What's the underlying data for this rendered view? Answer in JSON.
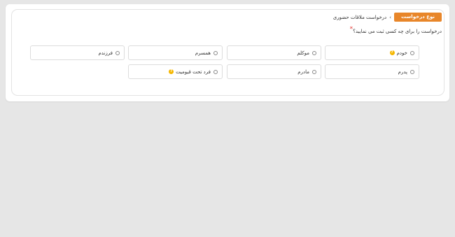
{
  "header": {
    "type_badge": "نوع درخواست",
    "separator": "‹",
    "breadcrumb_title": "درخواست ملاقات حضوری"
  },
  "question": {
    "text": "درخواست را برای چه کسی ثبت می نمایید؟",
    "required_mark": "*"
  },
  "options": {
    "self": {
      "label": "خودم",
      "help": "?"
    },
    "client": {
      "label": "موکلم"
    },
    "spouse": {
      "label": "همسرم"
    },
    "child": {
      "label": "فرزندم"
    },
    "father": {
      "label": "پدرم"
    },
    "mother": {
      "label": "مادرم"
    },
    "ward": {
      "label": "فرد تحت قیومیت",
      "help": "?"
    }
  },
  "colors": {
    "accent": "#e8862a",
    "help_icon": "#f5b700",
    "required": "#e53935"
  }
}
